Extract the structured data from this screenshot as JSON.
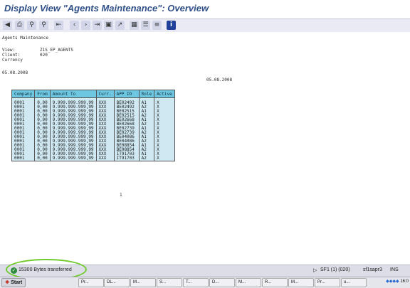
{
  "window": {
    "title": "Display View \"Agents Maintenance\": Overview"
  },
  "toolbar": {
    "icons": [
      "back-icon",
      "print-icon",
      "find-icon",
      "find-next-icon",
      "first-page-icon",
      "prev-page-icon",
      "next-page-icon",
      "last-page-icon",
      "new-session-icon",
      "shortcut-icon",
      "layout-icon",
      "table-icon",
      "details-icon",
      "help-icon"
    ]
  },
  "report": {
    "heading": "Agents Maintenance",
    "view_label": "View:",
    "view_value": "Z1S_EP_AGENTS",
    "client_label": "Client:",
    "client_value": "020",
    "currency_label": "Currency",
    "date_left": "05.08.2008",
    "date_right": "05.08.2008",
    "page_number": "1"
  },
  "table": {
    "headers": [
      "Company",
      "From",
      "Amount To",
      "Curr.",
      "APP ID",
      "Role",
      "Active"
    ],
    "rows": [
      [
        "0001",
        "0,00",
        "9.999.999.999,99",
        "XXX",
        "BE02492",
        "A1",
        "X"
      ],
      [
        "0001",
        "0,00",
        "9.999.999.999,99",
        "XXX",
        "BE02492",
        "A2",
        "X"
      ],
      [
        "0001",
        "0,00",
        "9.999.999.999,99",
        "XXX",
        "BE02515",
        "A1",
        "X"
      ],
      [
        "0001",
        "0,00",
        "9.999.999.999,99",
        "XXX",
        "BE02515",
        "A2",
        "X"
      ],
      [
        "0001",
        "0,00",
        "9.999.999.999,99",
        "XXX",
        "BE02668",
        "A1",
        "X"
      ],
      [
        "0001",
        "0,00",
        "9.999.999.999,99",
        "XXX",
        "BE02668",
        "A2",
        "X"
      ],
      [
        "0001",
        "0,00",
        "9.999.999.999,99",
        "XXX",
        "BE02739",
        "A1",
        "X"
      ],
      [
        "0001",
        "0,00",
        "9.999.999.999,99",
        "XXX",
        "BE02739",
        "A2",
        "X"
      ],
      [
        "0001",
        "0,00",
        "9.999.999.999,99",
        "XXX",
        "BE04086",
        "A1",
        "X"
      ],
      [
        "0001",
        "0,00",
        "9.999.999.999,99",
        "XXX",
        "BE04086",
        "A2",
        "X"
      ],
      [
        "0001",
        "0,00",
        "9.999.999.999,99",
        "XXX",
        "BE08854",
        "A1",
        "X"
      ],
      [
        "0001",
        "0,00",
        "9.999.999.999,99",
        "XXX",
        "BE08854",
        "A2",
        "X"
      ],
      [
        "0001",
        "0,00",
        "9.999.999.999,99",
        "XXX",
        "IT91703",
        "A1",
        "X"
      ],
      [
        "0001",
        "0,00",
        "9.999.999.999,99",
        "XXX",
        "IT91703",
        "A2",
        "X"
      ]
    ]
  },
  "status": {
    "message": "15300  Bytes transferred",
    "session": "SF1 (1) (020)",
    "server": "sf1sapr3",
    "mode": "INS"
  },
  "taskbar": {
    "start_label": "Start",
    "tasks": [
      "Pr...",
      "DL...",
      "M...",
      "S...",
      "T...",
      "D...",
      "M...",
      "R...",
      "M...",
      "Pr...",
      "u..."
    ],
    "clock": "16:0"
  },
  "colors": {
    "header": "#6ec7e0",
    "row": "#cfe8f2",
    "title": "#2f4f87",
    "highlight": "#6ecb2a"
  }
}
